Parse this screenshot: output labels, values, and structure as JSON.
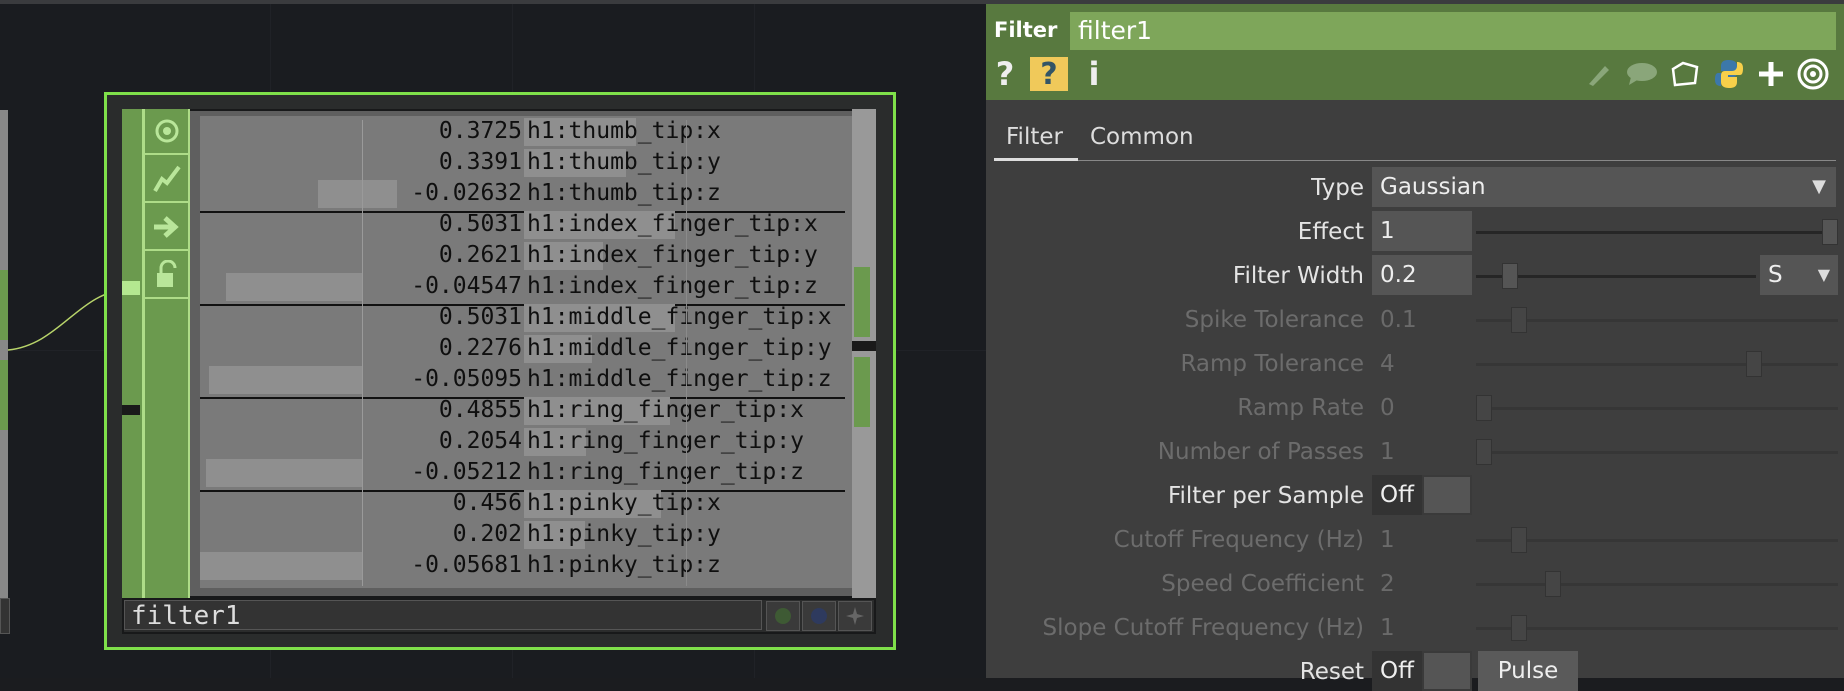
{
  "node": {
    "name": "filter1",
    "flags": [
      "viewer-flag-icon",
      "graph-flag-icon",
      "export-flag-icon",
      "lock-flag-icon"
    ],
    "channels": [
      {
        "value": "0.3725",
        "name": "h1:thumb_tip:x"
      },
      {
        "value": "0.3391",
        "name": "h1:thumb_tip:y"
      },
      {
        "value": "-0.02632",
        "name": "h1:thumb_tip:z"
      },
      {
        "value": "0.5031",
        "name": "h1:index_finger_tip:x"
      },
      {
        "value": "0.2621",
        "name": "h1:index_finger_tip:y"
      },
      {
        "value": "-0.04547",
        "name": "h1:index_finger_tip:z"
      },
      {
        "value": "0.5031",
        "name": "h1:middle_finger_tip:x"
      },
      {
        "value": "0.2276",
        "name": "h1:middle_finger_tip:y"
      },
      {
        "value": "-0.05095",
        "name": "h1:middle_finger_tip:z"
      },
      {
        "value": "0.4855",
        "name": "h1:ring_finger_tip:x"
      },
      {
        "value": "0.2054",
        "name": "h1:ring_finger_tip:y"
      },
      {
        "value": "-0.05212",
        "name": "h1:ring_finger_tip:z"
      },
      {
        "value": "0.456",
        "name": "h1:pinky_tip:x"
      },
      {
        "value": "0.202",
        "name": "h1:pinky_tip:y"
      },
      {
        "value": "-0.05681",
        "name": "h1:pinky_tip:z"
      }
    ]
  },
  "panel": {
    "op_type": "Filter",
    "op_name": "filter1",
    "tabs": [
      {
        "label": "Filter",
        "active": true
      },
      {
        "label": "Common",
        "active": false
      }
    ],
    "params": [
      {
        "label": "Type",
        "value": "Gaussian",
        "kind": "menu",
        "enabled": true
      },
      {
        "label": "Effect",
        "value": "1",
        "kind": "slider",
        "enabled": true,
        "level": 1.0
      },
      {
        "label": "Filter Width",
        "value": "0.2",
        "kind": "slider-unit",
        "unit": "S",
        "enabled": true,
        "level": 0.1
      },
      {
        "label": "Spike Tolerance",
        "value": "0.1",
        "kind": "slider",
        "enabled": false,
        "level": 0.1
      },
      {
        "label": "Ramp Tolerance",
        "value": "4",
        "kind": "slider",
        "enabled": false,
        "level": 0.78
      },
      {
        "label": "Ramp Rate",
        "value": "0",
        "kind": "slider",
        "enabled": false,
        "level": 0.0
      },
      {
        "label": "Number of Passes",
        "value": "1",
        "kind": "slider",
        "enabled": false,
        "level": 0.0
      },
      {
        "label": "Filter per Sample",
        "value": "Off",
        "kind": "toggle",
        "enabled": true
      },
      {
        "label": "Cutoff Frequency (Hz)",
        "value": "1",
        "kind": "slider",
        "enabled": false,
        "level": 0.1
      },
      {
        "label": "Speed Coefficient",
        "value": "2",
        "kind": "slider",
        "enabled": false,
        "level": 0.2
      },
      {
        "label": "Slope Cutoff Frequency (Hz)",
        "value": "1",
        "kind": "slider",
        "enabled": false,
        "level": 0.1
      },
      {
        "label": "Reset",
        "value": "Off",
        "kind": "toggle-pulse",
        "pulse_label": "Pulse",
        "enabled": true
      }
    ],
    "toolbar_icons": [
      "help-icon",
      "python-help-icon",
      "info-icon",
      "edit-icon",
      "comment-icon",
      "clone-icon",
      "python-icon",
      "add-icon",
      "target-icon"
    ]
  },
  "colors": {
    "accent": "#7fe04a",
    "header": "#58793f",
    "name_field": "#7ea65a"
  }
}
